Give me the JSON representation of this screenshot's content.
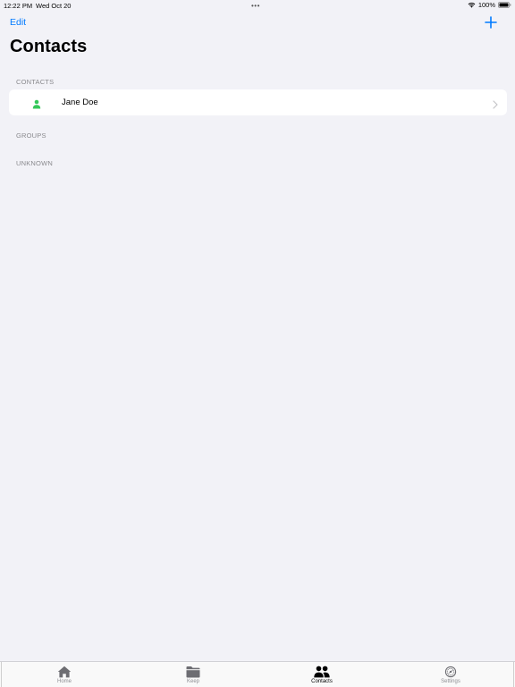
{
  "status_bar": {
    "time": "12:22 PM",
    "date": "Wed Oct 20",
    "battery_percent": "100%"
  },
  "nav": {
    "edit_label": "Edit",
    "add_icon": "plus-icon",
    "title": "Contacts"
  },
  "sections": {
    "contacts": {
      "header": "CONTACTS",
      "items": [
        {
          "name": "Jane Doe",
          "icon": "person-icon",
          "icon_color": "#34c759"
        }
      ]
    },
    "groups": {
      "header": "GROUPS"
    },
    "unknown": {
      "header": "UNKNOWN"
    }
  },
  "tab_bar": {
    "tabs": [
      {
        "label": "Home",
        "icon": "house-icon",
        "active": false
      },
      {
        "label": "Keep",
        "icon": "folder-icon",
        "active": false
      },
      {
        "label": "Contacts",
        "icon": "people-icon",
        "active": true
      },
      {
        "label": "Settings",
        "icon": "gear-icon",
        "active": false
      }
    ]
  },
  "colors": {
    "accent": "#007aff",
    "background": "#f2f2f7",
    "active_tab": "#000000",
    "inactive_tab": "#8e8e93"
  }
}
